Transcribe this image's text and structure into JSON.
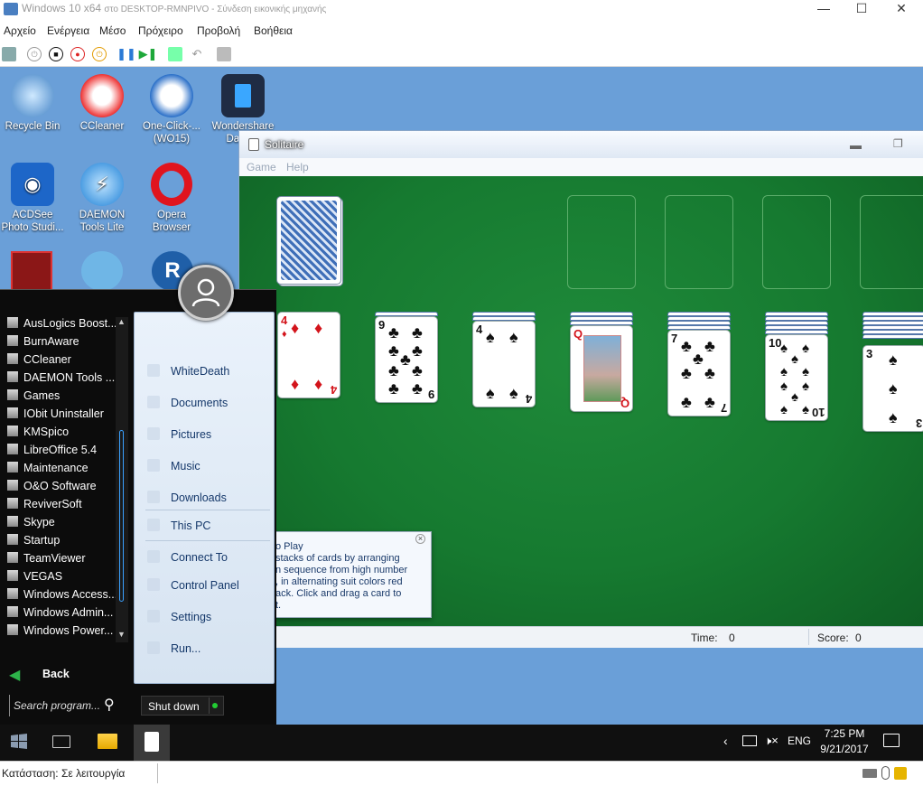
{
  "host": {
    "window_title": "Windows 10 x64",
    "window_title_sub": "στο DESKTOP-RMNPIVO - Σύνδεση εικονικής μηχανής",
    "menu": [
      "Αρχείο",
      "Ενέργεια",
      "Μέσο",
      "Πρόχειρο",
      "Προβολή",
      "Βοήθεια"
    ],
    "status_text": "Κατάσταση: Σε λειτουργία"
  },
  "desktop": {
    "icons": [
      {
        "label": "Recycle Bin",
        "icon": "recycle-bin-icon"
      },
      {
        "label": "CCleaner",
        "icon": "ccleaner-icon"
      },
      {
        "label": "One-Click-... (WO15)",
        "icon": "one-click-icon"
      },
      {
        "label": "Wondershare Data ...",
        "icon": "wondershare-icon"
      },
      {
        "label": "ACDSee Photo Studi...",
        "icon": "acdsee-icon"
      },
      {
        "label": "DAEMON Tools Lite",
        "icon": "daemon-tools-icon"
      },
      {
        "label": "Opera Browser",
        "icon": "opera-icon"
      }
    ]
  },
  "solitaire": {
    "title": "Solitaire",
    "menu": [
      "Game",
      "Help"
    ],
    "time_label": "Time:",
    "time_value": "0",
    "score_label": "Score:",
    "score_value": "0",
    "tip_text": "o Play\nstacks of cards by arranging\nn sequence from high number\n, in alternating suit colors red\nack. Click and drag a card to\nt."
  },
  "cards": {
    "c1": "4",
    "c2": "9",
    "c3": "4",
    "c4": "Q",
    "c5": "7",
    "c6": "10",
    "c7": "3"
  },
  "startmenu": {
    "programs": [
      "AusLogics Boost...",
      "BurnAware",
      "CCleaner",
      "DAEMON Tools ...",
      "Games",
      "IObit Uninstaller",
      "KMSpico",
      "LibreOffice 5.4",
      "Maintenance",
      "O&O Software",
      "ReviverSoft",
      "Skype",
      "Startup",
      "TeamViewer",
      "VEGAS",
      "Windows Access...",
      "Windows Admin...",
      "Windows Power..."
    ],
    "right_items": [
      "WhiteDeath",
      "Documents",
      "Pictures",
      "Music",
      "Downloads",
      "This PC",
      "Connect To",
      "Control Panel",
      "Settings",
      "Run..."
    ],
    "back_label": "Back",
    "search_placeholder": "Search program...",
    "shutdown_label": "Shut down"
  },
  "taskbar": {
    "language": "ENG",
    "time": "7:25 PM",
    "date": "9/21/2017"
  }
}
